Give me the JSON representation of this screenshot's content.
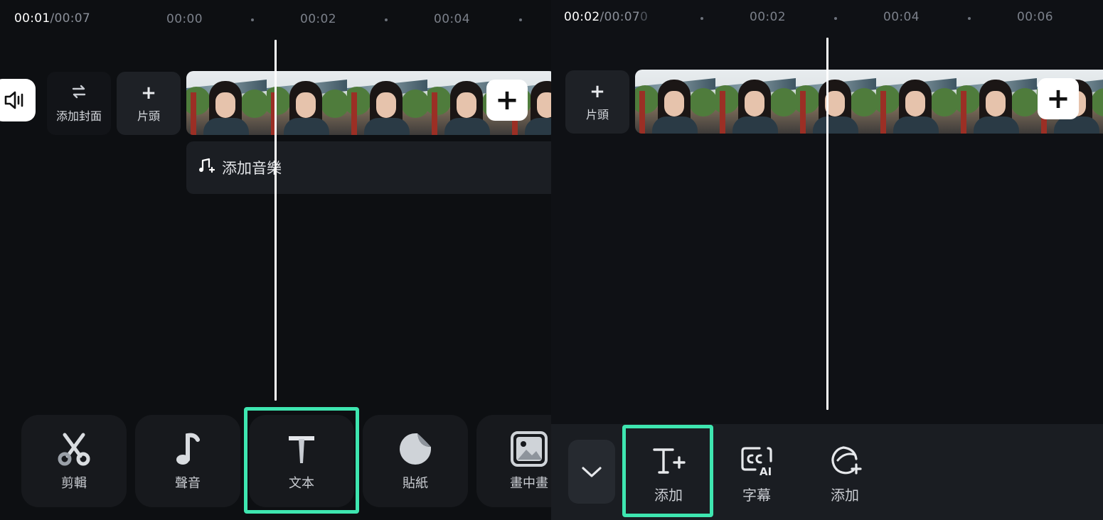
{
  "left": {
    "time_current": "00:01",
    "time_total": "/00:07",
    "ruler": [
      "00:00",
      "00:02",
      "00:04"
    ],
    "mute_icon": "speaker-mute-icon",
    "cover_tile": {
      "icon": "swap-icon",
      "label": "添加封面"
    },
    "intro_tile": {
      "icon": "plus-icon",
      "label": "片頭"
    },
    "add_clip_icon": "plus-icon",
    "music_track": {
      "icon": "music-add-icon",
      "label": "添加音樂"
    },
    "tools": [
      {
        "icon": "scissors-icon",
        "label": "剪輯"
      },
      {
        "icon": "music-note-icon",
        "label": "聲音"
      },
      {
        "icon": "text-t-icon",
        "label": "文本"
      },
      {
        "icon": "sticker-icon",
        "label": "貼紙"
      },
      {
        "icon": "picture-in-picture-icon",
        "label": "畫中畫"
      }
    ],
    "highlight_color": "#3ee6b0"
  },
  "right": {
    "time_current": "00:02",
    "time_total": "/00:07",
    "ruler_trailing": "0",
    "ruler": [
      "00:02",
      "00:04",
      "00:06"
    ],
    "intro_tile": {
      "icon": "plus-icon",
      "label": "片頭"
    },
    "add_clip_icon": "plus-icon",
    "collapse_icon": "chevron-down-icon",
    "tools": [
      {
        "icon": "text-add-icon",
        "label": "添加"
      },
      {
        "icon": "cc-ai-icon",
        "label": "字幕"
      },
      {
        "icon": "sticker-add-icon",
        "label": "添加"
      }
    ],
    "highlight_color": "#3ee6b0"
  }
}
